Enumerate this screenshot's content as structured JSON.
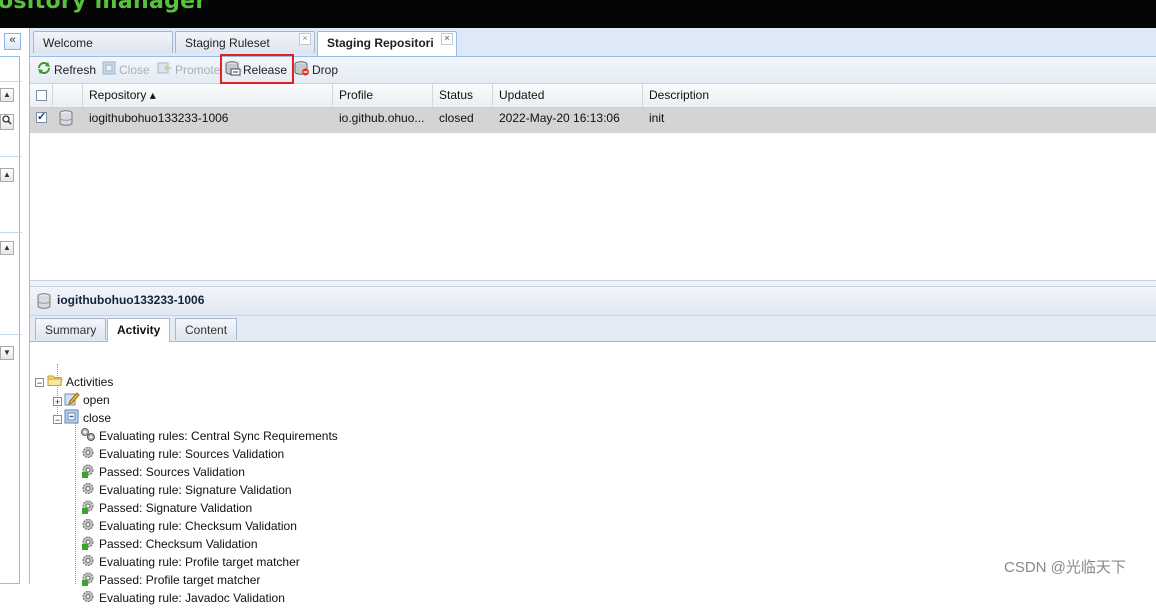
{
  "header": {
    "app_title": "ository manager"
  },
  "left_panel": {
    "collapse_label": "«"
  },
  "tabs": [
    {
      "label": "Welcome"
    },
    {
      "label": "Staging Ruleset"
    },
    {
      "label": "Staging Repositori"
    }
  ],
  "toolbar": {
    "refresh": "Refresh",
    "close": "Close",
    "promote": "Promote",
    "release": "Release",
    "drop": "Drop"
  },
  "grid": {
    "columns": [
      "Repository ▴",
      "Profile",
      "Status",
      "Updated",
      "Description"
    ],
    "rows": [
      {
        "repository": "iogithubohuo133233-1006",
        "profile": "io.github.ohuo...",
        "status": "closed",
        "updated": "2022-May-20 16:13:06",
        "description": "init"
      }
    ]
  },
  "detail": {
    "title": "iogithubohuo133233-1006",
    "tabs": [
      "Summary",
      "Activity",
      "Content"
    ],
    "active_tab": "Activity"
  },
  "tree": {
    "root": "Activities",
    "open": "open",
    "close": "close",
    "items": [
      "Evaluating rules: Central Sync Requirements",
      "Evaluating rule: Sources Validation",
      "Passed: Sources Validation",
      "Evaluating rule: Signature Validation",
      "Passed: Signature Validation",
      "Evaluating rule: Checksum Validation",
      "Passed: Checksum Validation",
      "Evaluating rule: Profile target matcher",
      "Passed: Profile target matcher",
      "Evaluating rule: Javadoc Validation"
    ]
  },
  "watermark": "CSDN @光临天下",
  "colors": {
    "accent_green": "#58c23d",
    "highlight_red": "#e41f1f",
    "selected_row": "#d4d4d4"
  }
}
